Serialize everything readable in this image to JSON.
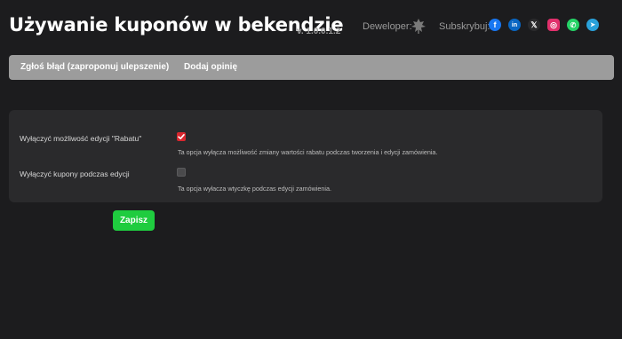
{
  "header": {
    "title": "Używanie kuponów w bekendzie",
    "version": "v. 1.0.0.1.2",
    "developer_label": "Deweloper:",
    "developer_logo_icon": "leaf-logo-icon",
    "subscribe_label": "Subskrybuj:",
    "social": [
      {
        "name": "facebook-icon",
        "glyph": "f",
        "color": "#1877f2"
      },
      {
        "name": "linkedin-icon",
        "glyph": "in",
        "color": "#0a66c2"
      },
      {
        "name": "x-twitter-icon",
        "glyph": "𝕏",
        "color": "#2a2a2c"
      },
      {
        "name": "instagram-icon",
        "glyph": "◎",
        "color": "#e1306c"
      },
      {
        "name": "whatsapp-icon",
        "glyph": "✆",
        "color": "#25d366"
      },
      {
        "name": "telegram-icon",
        "glyph": "➤",
        "color": "#2aa1da"
      }
    ]
  },
  "nav": {
    "report_bug": "Zgłoś błąd (zaproponuj ulepszenie)",
    "add_review": "Dodaj opinię"
  },
  "settings": {
    "rows": [
      {
        "label": "Wyłączyć możliwość edycji \"Rabatu\"",
        "checked": true,
        "description": "Ta opcja wyłącza możliwość zmiany wartości rabatu podczas tworzenia i edycji zamówienia."
      },
      {
        "label": "Wyłączyć kupony podczas edycji",
        "checked": false,
        "description": "Ta opcja wyłacza wtyczkę podczas edycji zamówienia."
      }
    ]
  },
  "actions": {
    "save_label": "Zapisz"
  },
  "colors": {
    "background": "#1c1c1e",
    "panel": "#2a2a2c",
    "nav_bar": "#9c9c9c",
    "checkbox_checked": "#d9262e",
    "save_button": "#1fcc3f"
  }
}
